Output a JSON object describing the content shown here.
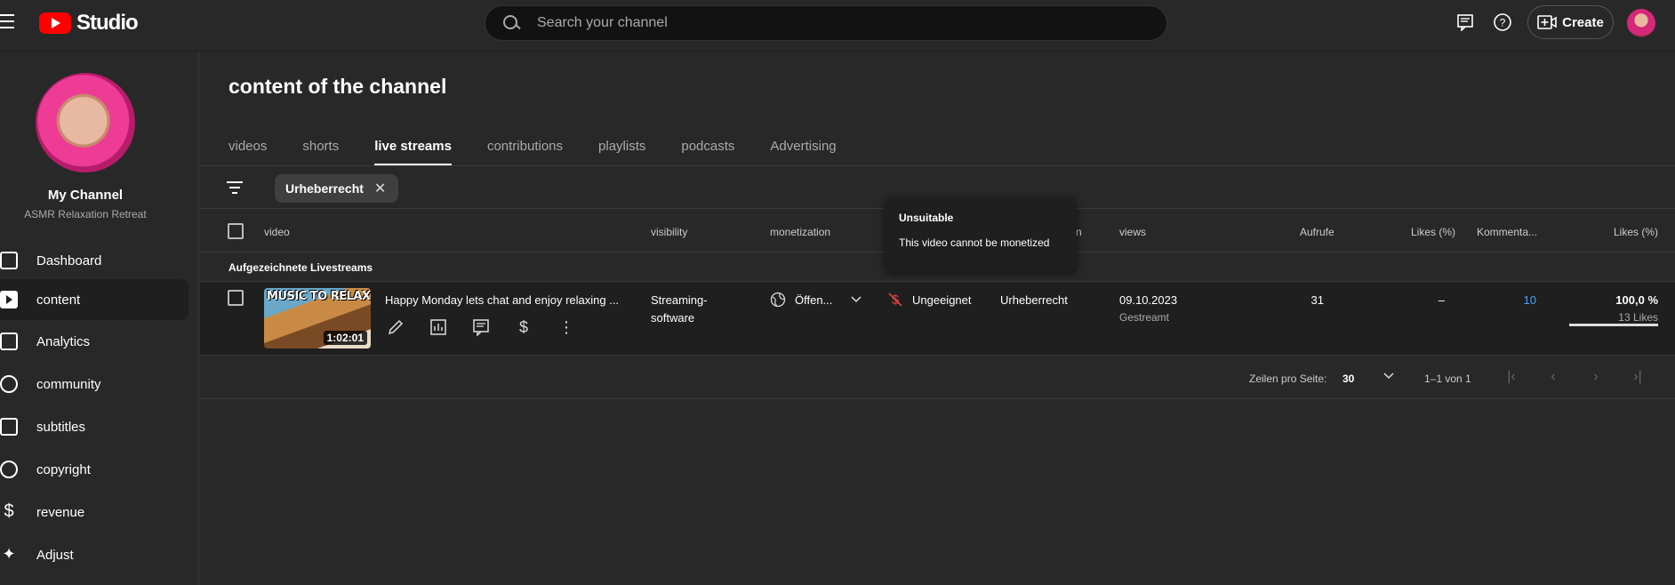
{
  "app": {
    "title": "Studio"
  },
  "search": {
    "placeholder": "Search your channel"
  },
  "topbar": {
    "create_label": "Create"
  },
  "channel": {
    "name": "My Channel",
    "subtitle": "ASMR Relaxation Retreat"
  },
  "sidebar": {
    "items": [
      {
        "label": "Dashboard",
        "icon": "dashboard-icon"
      },
      {
        "label": "content",
        "icon": "content-icon",
        "active": true
      },
      {
        "label": "Analytics",
        "icon": "analytics-icon"
      },
      {
        "label": "community",
        "icon": "community-icon"
      },
      {
        "label": "subtitles",
        "icon": "subtitles-icon"
      },
      {
        "label": "copyright",
        "icon": "copyright-icon"
      },
      {
        "label": "revenue",
        "icon": "revenue-icon"
      },
      {
        "label": "Adjust",
        "icon": "magic-wand-icon"
      }
    ]
  },
  "main": {
    "title": "content of the channel",
    "tabs": [
      {
        "label": "videos"
      },
      {
        "label": "shorts"
      },
      {
        "label": "live streams",
        "active": true
      },
      {
        "label": "contributions"
      },
      {
        "label": "playlists"
      },
      {
        "label": "podcasts"
      },
      {
        "label": "Advertising"
      }
    ],
    "filter_chip": "Urheberrecht"
  },
  "table": {
    "headers": {
      "video": "video",
      "visibility": "visibility",
      "monetization": "monetization",
      "restrictions_partial": "n",
      "views": "views",
      "aufrufe": "Aufrufe",
      "likes_pct": "Likes (%)",
      "comments": "Kommenta...",
      "likes_pct2": "Likes (%)"
    },
    "group_label": "Aufgezeichnete Livestreams",
    "rows": [
      {
        "thumb_text": "MUSIC TO RELAX",
        "duration": "1:02:01",
        "title": "Happy Monday lets chat and enjoy relaxing ...",
        "visibility_line1": "Streaming-",
        "visibility_line2": "software",
        "monetization_status": "Öffen...",
        "ad_suitability": "Ungeeignet",
        "restriction": "Urheberrecht",
        "date": "09.10.2023",
        "date_sub": "Gestreamt",
        "aufrufe": "31",
        "likes_pct": "–",
        "comments": "10",
        "likes_value": "100,0 %",
        "likes_count": "13 Likes",
        "likes_ratio": 1.0
      }
    ]
  },
  "pager": {
    "rows_label": "Zeilen pro Seite:",
    "rows_value": "30",
    "range": "1–1 von 1"
  },
  "tooltip": {
    "title": "Unsuitable",
    "body": "This video cannot be monetized"
  },
  "colors": {
    "accent_red": "#ff0000",
    "link_blue": "#3ea6ff",
    "background": "#282828"
  }
}
